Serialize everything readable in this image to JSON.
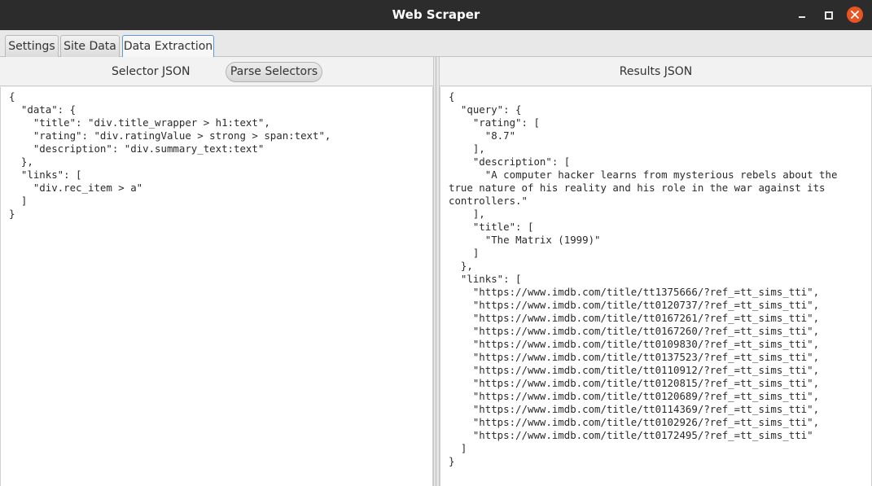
{
  "window": {
    "title": "Web Scraper",
    "minimize_icon": "minimize-icon",
    "maximize_icon": "maximize-icon",
    "close_icon": "close-icon",
    "close_color": "#e95420"
  },
  "tabs": [
    {
      "label": "Settings"
    },
    {
      "label": "Site Data"
    },
    {
      "label": "Data Extraction",
      "selected": true
    }
  ],
  "selector_panel": {
    "header": "Selector JSON",
    "parse_button": "Parse Selectors",
    "content": "{\n  \"data\": {\n    \"title\": \"div.title_wrapper > h1:text\",\n    \"rating\": \"div.ratingValue > strong > span:text\",\n    \"description\": \"div.summary_text:text\"\n  },\n  \"links\": [\n    \"div.rec_item > a\"\n  ]\n}"
  },
  "results_panel": {
    "header": "Results JSON",
    "content": "{\n  \"query\": {\n    \"rating\": [\n      \"8.7\"\n    ],\n    \"description\": [\n      \"A computer hacker learns from mysterious rebels about the true nature of his reality and his role in the war against its controllers.\"\n    ],\n    \"title\": [\n      \"The Matrix (1999)\"\n    ]\n  },\n  \"links\": [\n    \"https://www.imdb.com/title/tt1375666/?ref_=tt_sims_tti\",\n    \"https://www.imdb.com/title/tt0120737/?ref_=tt_sims_tti\",\n    \"https://www.imdb.com/title/tt0167261/?ref_=tt_sims_tti\",\n    \"https://www.imdb.com/title/tt0167260/?ref_=tt_sims_tti\",\n    \"https://www.imdb.com/title/tt0109830/?ref_=tt_sims_tti\",\n    \"https://www.imdb.com/title/tt0137523/?ref_=tt_sims_tti\",\n    \"https://www.imdb.com/title/tt0110912/?ref_=tt_sims_tti\",\n    \"https://www.imdb.com/title/tt0120815/?ref_=tt_sims_tti\",\n    \"https://www.imdb.com/title/tt0120689/?ref_=tt_sims_tti\",\n    \"https://www.imdb.com/title/tt0114369/?ref_=tt_sims_tti\",\n    \"https://www.imdb.com/title/tt0102926/?ref_=tt_sims_tti\",\n    \"https://www.imdb.com/title/tt0172495/?ref_=tt_sims_tti\"\n  ]\n}"
  }
}
